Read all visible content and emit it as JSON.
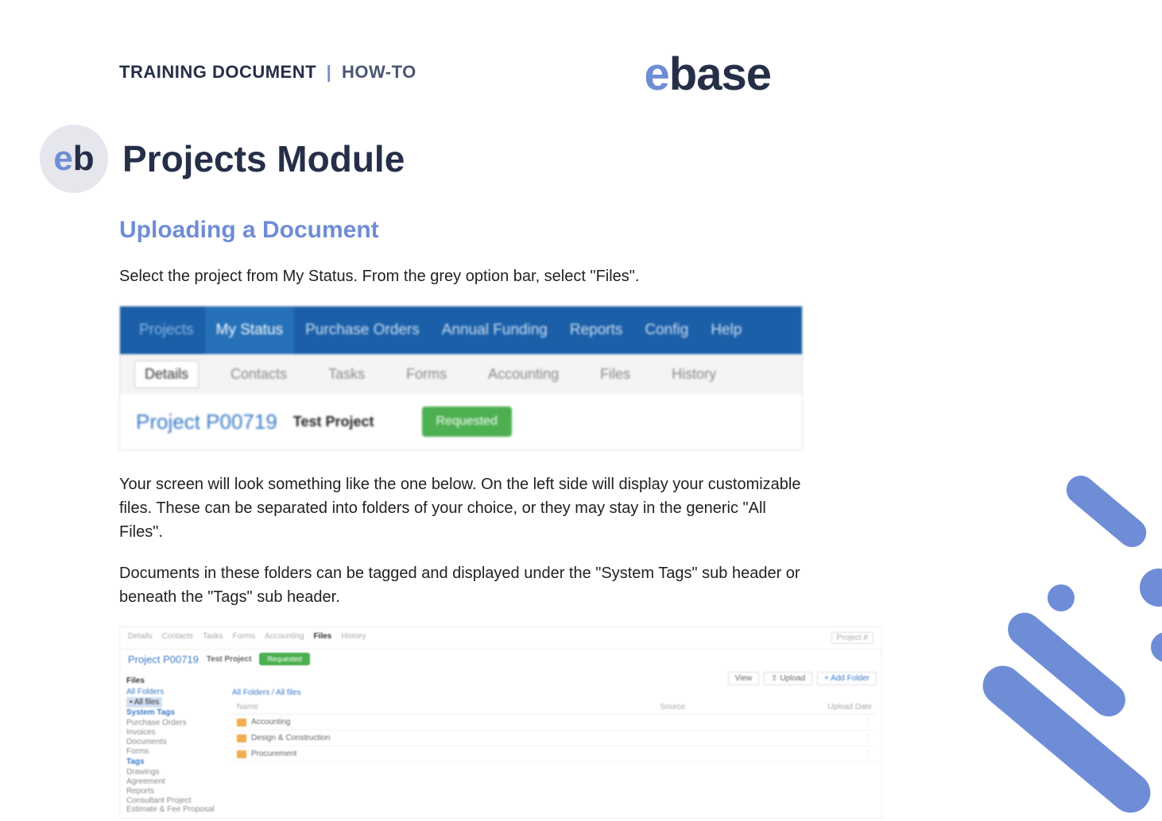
{
  "header": {
    "tagline_left": "TRAINING DOCUMENT",
    "tagline_sep": "|",
    "tagline_right": "HOW-TO",
    "logo_e": "e",
    "logo_rest": "base"
  },
  "circle": {
    "e": "e",
    "b": "b"
  },
  "title": "Projects Module",
  "section": "Uploading a Document",
  "para1": "Select the project from My Status. From the grey option bar, select \"Files\".",
  "shot1": {
    "nav": [
      "Projects",
      "My Status",
      "Purchase Orders",
      "Annual Funding",
      "Reports",
      "Config",
      "Help"
    ],
    "nav_active_index": 1,
    "sub": [
      "Details",
      "Contacts",
      "Tasks",
      "Forms",
      "Accounting",
      "Files",
      "History"
    ],
    "sub_active_index": 0,
    "project_id": "Project P00719",
    "project_name": "Test Project",
    "status": "Requested"
  },
  "para2": "Your screen will look something like the one below. On the left side will display your customizable files. These can be separated into folders of your choice, or they may stay in the generic \"All Files\".",
  "para3": "Documents in these folders can be tagged and displayed under the \"System Tags\" sub header or beneath the \"Tags\" sub header.",
  "shot2": {
    "tabs": [
      "Details",
      "Contacts",
      "Tasks",
      "Forms",
      "Accounting",
      "Files",
      "History"
    ],
    "tabs_active_index": 5,
    "project_number_label": "Project #",
    "project_id": "Project P00719",
    "project_name": "Test Project",
    "status": "Requested",
    "side": {
      "files_header": "Files",
      "all_folders": "All Folders",
      "all_files": "• All files",
      "system_tags_header": "System Tags",
      "system_tags": [
        "Purchase Orders",
        "Invoices",
        "Documents",
        "Forms"
      ],
      "tags_header": "Tags",
      "tags": [
        "Drawings",
        "Agreement",
        "Reports",
        "Consultant Project Estimate & Fee Proposal"
      ]
    },
    "toolbar": {
      "view": "View",
      "upload": "⇧ Upload",
      "add_folder": "+ Add Folder"
    },
    "breadcrumb": "All Folders / All files",
    "columns": {
      "name": "Name",
      "source": "Source",
      "upload_date": "Upload Date"
    },
    "rows": [
      {
        "name": "Accounting",
        "dots": "⋮"
      },
      {
        "name": "Design & Construction",
        "dots": "⋮"
      },
      {
        "name": "Procurement",
        "dots": "⋮"
      }
    ]
  }
}
